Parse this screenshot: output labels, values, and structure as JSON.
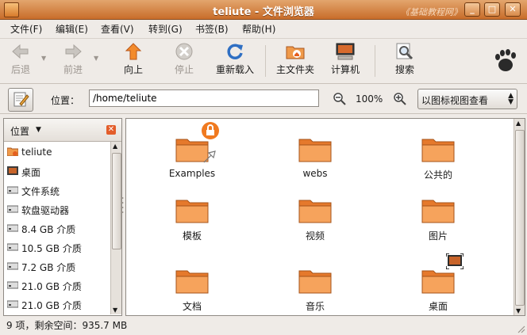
{
  "window": {
    "title": "teliute - 文件浏览器",
    "watermark": "《基础教程网》",
    "controls": {
      "minimize": "_",
      "maximize": "□",
      "close": "✕"
    }
  },
  "menubar": [
    {
      "label": "文件(F)"
    },
    {
      "label": "编辑(E)"
    },
    {
      "label": "查看(V)"
    },
    {
      "label": "转到(G)"
    },
    {
      "label": "书签(B)"
    },
    {
      "label": "帮助(H)"
    }
  ],
  "toolbar": {
    "back": "后退",
    "forward": "前进",
    "up": "向上",
    "stop": "停止",
    "reload": "重新载入",
    "home": "主文件夹",
    "computer": "计算机",
    "search": "搜索"
  },
  "location": {
    "label": "位置：",
    "path": "/home/teliute",
    "zoom": "100%",
    "view_mode": "以图标视图查看"
  },
  "sidebar": {
    "header": "位置",
    "items": [
      {
        "label": "teliute",
        "icon": "home-icon"
      },
      {
        "label": "桌面",
        "icon": "desktop-icon"
      },
      {
        "label": "文件系统",
        "icon": "drive-icon"
      },
      {
        "label": "软盘驱动器",
        "icon": "drive-icon"
      },
      {
        "label": "8.4 GB 介质",
        "icon": "drive-icon"
      },
      {
        "label": "10.5 GB 介质",
        "icon": "drive-icon"
      },
      {
        "label": "7.2 GB 介质",
        "icon": "drive-icon"
      },
      {
        "label": "21.0 GB 介质",
        "icon": "drive-icon"
      },
      {
        "label": "21.0 GB 介质",
        "icon": "drive-icon"
      }
    ]
  },
  "files": [
    {
      "name": "Examples",
      "emblems": [
        "lock-emblem-icon",
        "link-emblem-icon"
      ]
    },
    {
      "name": "webs"
    },
    {
      "name": "公共的"
    },
    {
      "name": "模板"
    },
    {
      "name": "视频"
    },
    {
      "name": "图片"
    },
    {
      "name": "文档"
    },
    {
      "name": "音乐"
    },
    {
      "name": "桌面",
      "emblems": [
        "desktop-emblem-icon"
      ]
    }
  ],
  "status": {
    "text": "9 项，剩余空间：935.7 MB"
  },
  "colors": {
    "title_bar": "#c86d2a",
    "folder": "#f0893a",
    "accent": "#e35d2a"
  }
}
